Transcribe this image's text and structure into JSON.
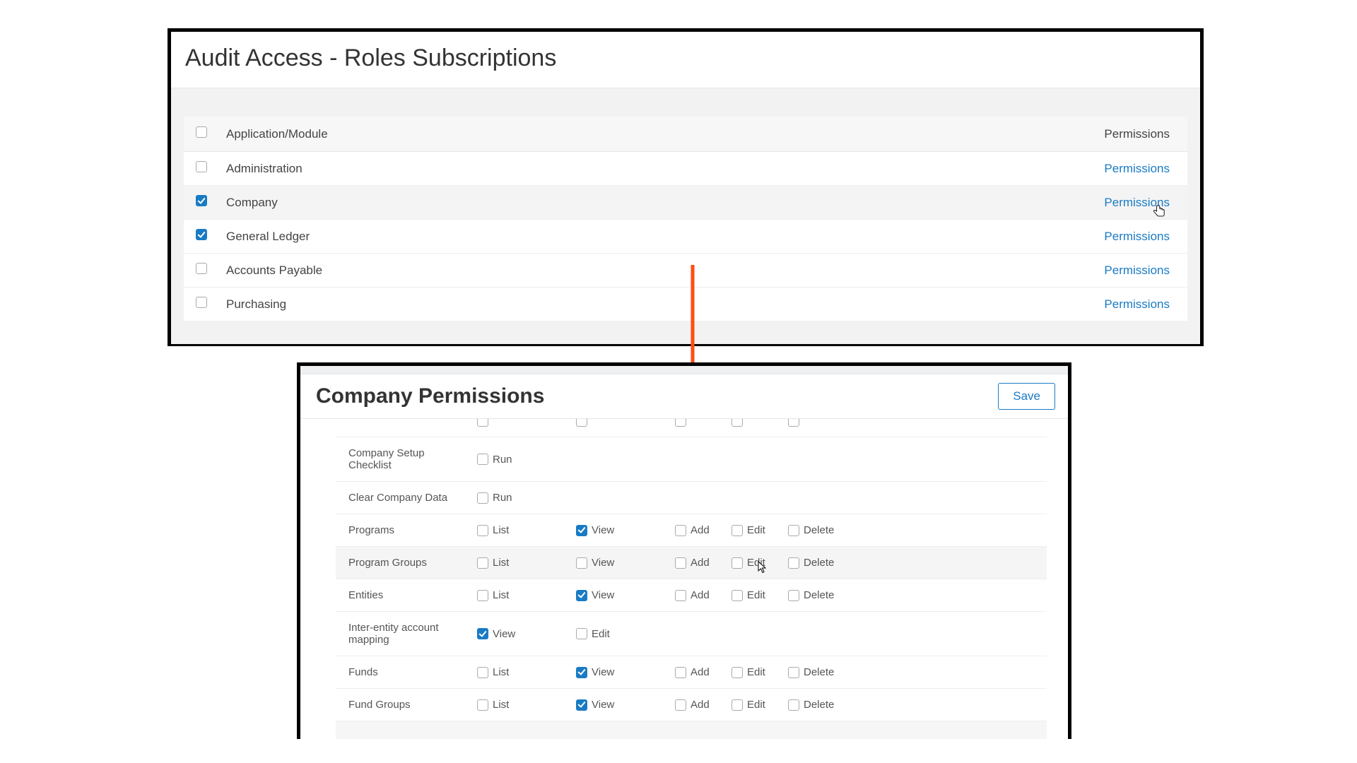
{
  "top": {
    "title": "Audit Access - Roles Subscriptions",
    "header_col": "Application/Module",
    "perm_col": "Permissions",
    "modules": [
      {
        "name": "Administration",
        "checked": false,
        "link": "Permissions"
      },
      {
        "name": "Company",
        "checked": true,
        "link": "Permissions"
      },
      {
        "name": "General Ledger",
        "checked": true,
        "link": "Permissions"
      },
      {
        "name": "Accounts Payable",
        "checked": false,
        "link": "Permissions"
      },
      {
        "name": "Purchasing",
        "checked": false,
        "link": "Permissions"
      }
    ]
  },
  "bottom": {
    "title": "Company Permissions",
    "save_label": "Save",
    "opt_labels": {
      "list": "List",
      "view": "View",
      "add": "Add",
      "edit": "Edit",
      "delete": "Delete",
      "run": "Run"
    },
    "rows": {
      "setup_checklist": "Company Setup Checklist",
      "clear_data": "Clear Company Data",
      "programs": "Programs",
      "program_groups": "Program Groups",
      "entities": "Entities",
      "inter_entity": "Inter-entity account mapping",
      "funds": "Funds",
      "fund_groups": "Fund Groups"
    },
    "checked": {
      "programs_view": true,
      "entities_view": true,
      "inter_entity_view": true,
      "funds_view": true,
      "fund_groups_view": true
    }
  }
}
